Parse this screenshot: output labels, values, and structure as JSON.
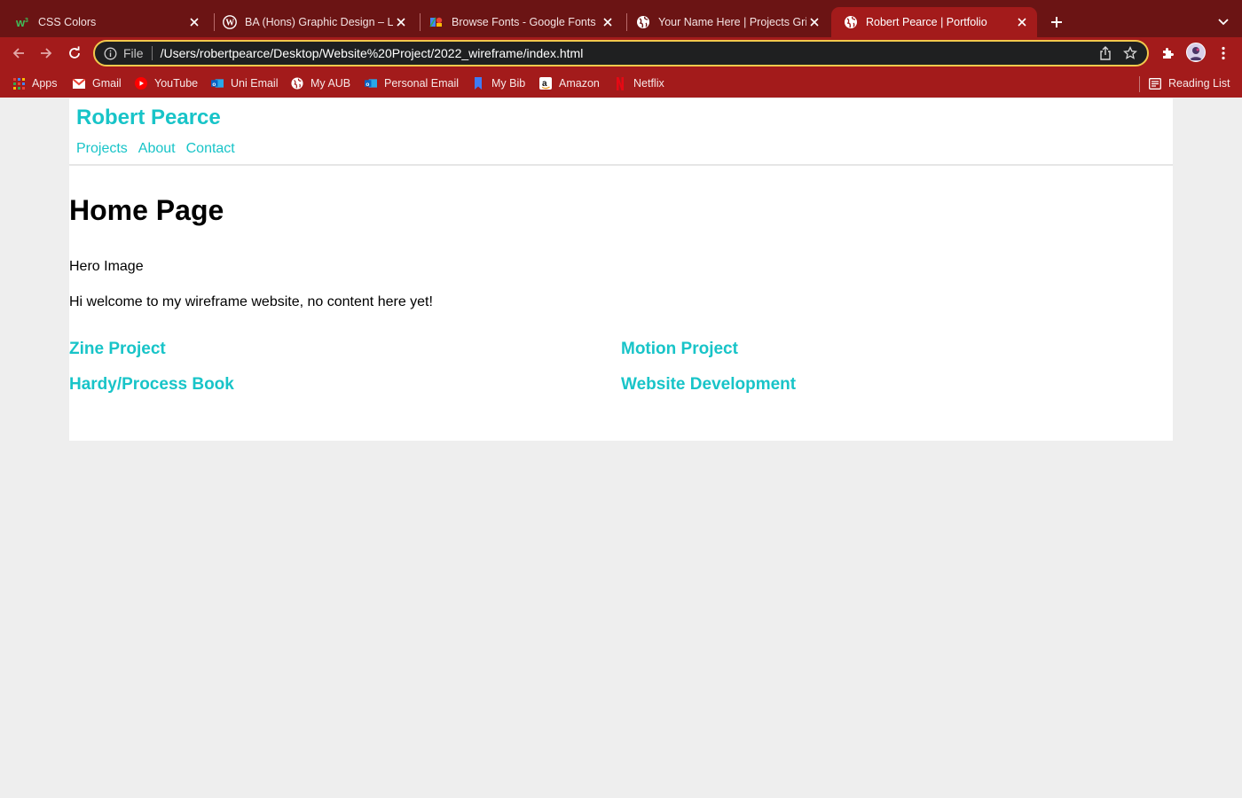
{
  "browser": {
    "tabs": [
      {
        "title": "CSS Colors",
        "icon": "w3schools-icon",
        "active": false
      },
      {
        "title": "BA (Hons) Graphic Design – Le",
        "icon": "wordpress-icon",
        "active": false
      },
      {
        "title": "Browse Fonts - Google Fonts",
        "icon": "google-fonts-icon",
        "active": false
      },
      {
        "title": "Your Name Here | Projects Grid",
        "icon": "globe-icon",
        "active": false
      },
      {
        "title": "Robert Pearce | Portfolio",
        "icon": "globe-icon",
        "active": true
      }
    ],
    "address": {
      "scheme_label": "File",
      "url": "/Users/robertpearce/Desktop/Website%20Project/2022_wireframe/index.html"
    },
    "bookmarks": [
      {
        "label": "Apps",
        "icon": "apps-grid-icon"
      },
      {
        "label": "Gmail",
        "icon": "gmail-icon"
      },
      {
        "label": "YouTube",
        "icon": "youtube-icon"
      },
      {
        "label": "Uni Email",
        "icon": "outlook-icon"
      },
      {
        "label": "My AUB",
        "icon": "globe-icon"
      },
      {
        "label": "Personal Email",
        "icon": "outlook-icon"
      },
      {
        "label": "My Bib",
        "icon": "bookmark-icon"
      },
      {
        "label": "Amazon",
        "icon": "amazon-icon"
      },
      {
        "label": "Netflix",
        "icon": "netflix-icon"
      }
    ],
    "reading_list": "Reading List",
    "colors": {
      "frame": "#a31b1b",
      "tabstrip": "#6b1414",
      "omnibox_border": "#f2c94c"
    }
  },
  "site": {
    "title": "Robert Pearce",
    "nav": [
      "Projects",
      "About",
      "Contact"
    ],
    "accent": "#18c4c8"
  },
  "main": {
    "heading": "Home Page",
    "hero": "Hero Image",
    "welcome": "Hi welcome to my wireframe website, no content here yet!",
    "projects": [
      "Zine Project",
      "Motion Project",
      "Hardy/Process Book",
      "Website Development"
    ]
  }
}
